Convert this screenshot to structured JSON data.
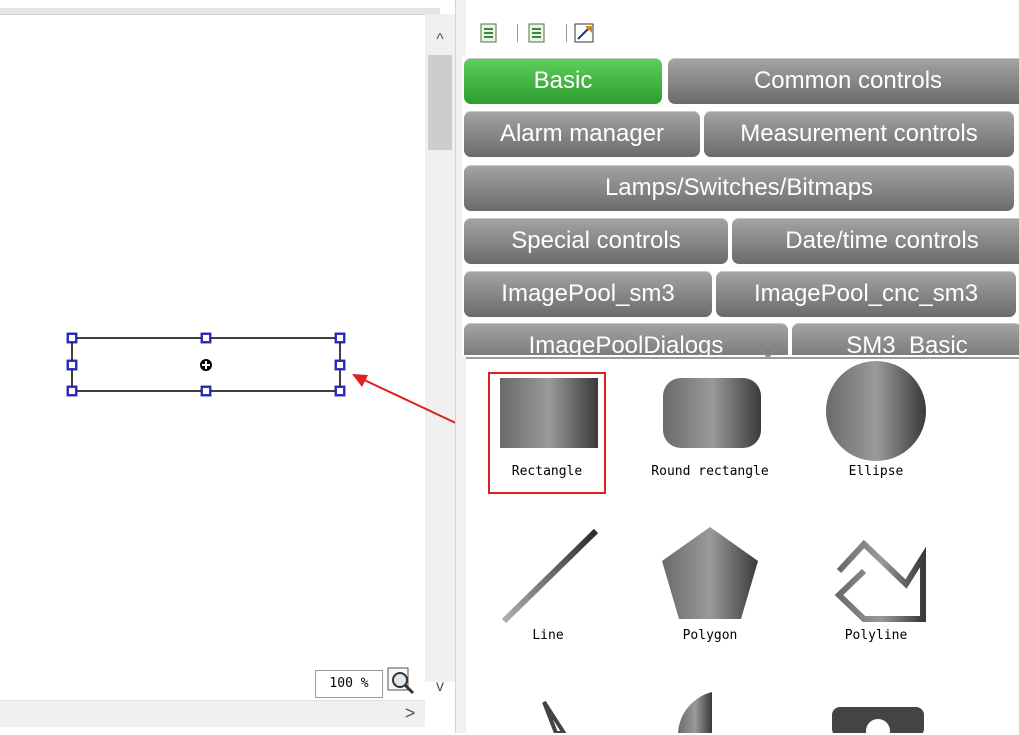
{
  "editor": {
    "zoom_value": "100 %",
    "scroll_up": "^",
    "scroll_down": "v",
    "scroll_right": ">"
  },
  "toolbox": {
    "toolbar_icons": [
      "page-icon",
      "page-icon",
      "wizard-icon"
    ],
    "tabs": [
      {
        "label": "Basic",
        "active": true
      },
      {
        "label": "Common controls",
        "active": false
      },
      {
        "label": "Alarm manager",
        "active": false
      },
      {
        "label": "Measurement controls",
        "active": false
      },
      {
        "label": "Lamps/Switches/Bitmaps",
        "active": false
      },
      {
        "label": "Special controls",
        "active": false
      },
      {
        "label": "Date/time controls",
        "active": false
      },
      {
        "label": "ImagePool_sm3",
        "active": false
      },
      {
        "label": "ImagePool_cnc_sm3",
        "active": false
      },
      {
        "label": "ImagePoolDialogs",
        "active": false
      },
      {
        "label": "SM3_Basic",
        "active": false
      }
    ],
    "shapes": [
      {
        "label": "Rectangle"
      },
      {
        "label": "Round rectangle"
      },
      {
        "label": "Ellipse"
      },
      {
        "label": "Line"
      },
      {
        "label": "Polygon"
      },
      {
        "label": "Polyline"
      }
    ]
  },
  "colors": {
    "active_tab": "#3fb53f",
    "inactive_tab": "#7a7a7a",
    "highlight": "#e02020",
    "selection_handle": "#3333cc"
  }
}
